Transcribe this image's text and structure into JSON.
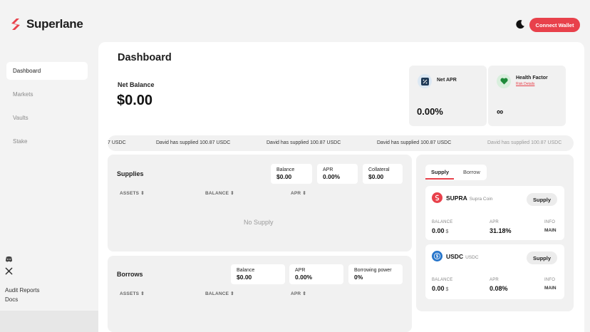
{
  "brand": {
    "name": "Superlane"
  },
  "header": {
    "theme_icon": "moon-icon",
    "connect_label": "Connect Wallet"
  },
  "nav": {
    "items": [
      {
        "label": "Dashboard",
        "active": true
      },
      {
        "label": "Markets"
      },
      {
        "label": "Vaults"
      },
      {
        "label": "Stake"
      }
    ]
  },
  "social": {
    "icons": [
      "discord-icon",
      "x-icon"
    ]
  },
  "footer": {
    "links": [
      "Audit Reports",
      "Docs"
    ]
  },
  "dashboard": {
    "title": "Dashboard",
    "net_balance_label": "Net Balance",
    "net_balance_value": "$0.00",
    "net_apr": {
      "label": "Net APR",
      "value": "0.00%",
      "icon": "percent-icon"
    },
    "health_factor": {
      "label": "Health Factor",
      "sub": "Risk Details",
      "value": "∞",
      "icon": "heart-icon"
    }
  },
  "ticker": {
    "items": [
      "7 USDC",
      "David has supplied 100.87 USDC",
      "David has supplied 100.87 USDC",
      "David has supplied 100.87 USDC",
      "David has supplied 100.87 USDC"
    ]
  },
  "supplies": {
    "title": "Supplies",
    "stats": [
      {
        "label": "Balance",
        "value": "$0.00"
      },
      {
        "label": "APR",
        "value": "0.00%"
      },
      {
        "label": "Collateral",
        "value": "$0.00"
      }
    ],
    "columns": [
      "ASSETS ⇕",
      "BALANCE ⇕",
      "APR ⇕"
    ],
    "empty": "No Supply"
  },
  "borrows": {
    "title": "Borrows",
    "stats": [
      {
        "label": "Balance",
        "value": "$0.00"
      },
      {
        "label": "APR",
        "value": "0.00%"
      },
      {
        "label": "Borrowing power",
        "value": "0%"
      }
    ],
    "columns": [
      "ASSETS ⇕",
      "BALANCE ⇕",
      "APR ⇕"
    ]
  },
  "market": {
    "tabs": [
      {
        "label": "Supply",
        "active": true
      },
      {
        "label": "Borrow"
      }
    ],
    "assets": [
      {
        "symbol": "SUPRA",
        "name": "Supra Coin",
        "action": "Supply",
        "balance_label": "BALANCE",
        "balance_value": "0.00",
        "balance_unit": "$",
        "apr_label": "APR",
        "apr_value": "31.18%",
        "info_label": "INFO",
        "info_value": "MAIN",
        "icon": "supra-coin-icon",
        "color": "#e8414b"
      },
      {
        "symbol": "USDC",
        "name": "USDC",
        "action": "Supply",
        "balance_label": "BALANCE",
        "balance_value": "0.00",
        "balance_unit": "$",
        "apr_label": "APR",
        "apr_value": "0.08%",
        "info_label": "INFO",
        "info_value": "MAIN",
        "icon": "usdc-coin-icon",
        "color": "#2775ca"
      }
    ]
  },
  "colors": {
    "accent": "#e8414b",
    "panel": "#f1f1f1",
    "background": "#f3f3f3"
  }
}
